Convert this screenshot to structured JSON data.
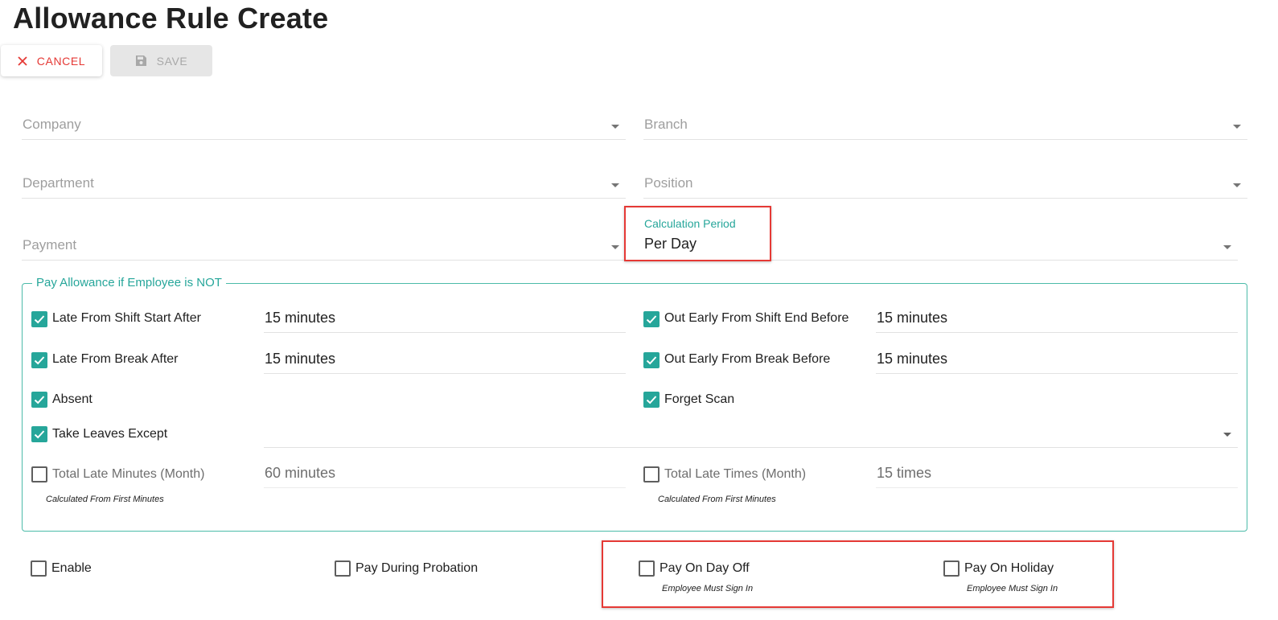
{
  "page": {
    "title": "Allowance Rule Create"
  },
  "toolbar": {
    "cancel_label": "CANCEL",
    "save_label": "SAVE"
  },
  "filters": {
    "company": {
      "placeholder": "Company"
    },
    "branch": {
      "placeholder": "Branch"
    },
    "department": {
      "placeholder": "Department"
    },
    "position": {
      "placeholder": "Position"
    },
    "payment": {
      "placeholder": "Payment"
    },
    "calculation_period": {
      "label": "Calculation Period",
      "value": "Per Day"
    }
  },
  "not_section": {
    "legend": "Pay Allowance if Employee is NOT",
    "late_shift_start": {
      "label": "Late From Shift Start After",
      "checked": true,
      "value": "15 minutes"
    },
    "out_early_shift_end": {
      "label": "Out Early From Shift End Before",
      "checked": true,
      "value": "15 minutes"
    },
    "late_break": {
      "label": "Late From Break After",
      "checked": true,
      "value": "15 minutes"
    },
    "out_early_break": {
      "label": "Out Early From Break Before",
      "checked": true,
      "value": "15 minutes"
    },
    "absent": {
      "label": "Absent",
      "checked": true
    },
    "forget_scan": {
      "label": "Forget Scan",
      "checked": true
    },
    "take_leaves": {
      "label": "Take Leaves Except",
      "checked": true,
      "value": ""
    },
    "total_late_minutes": {
      "label": "Total Late Minutes (Month)",
      "checked": false,
      "value": "60 minutes",
      "hint": "Calculated From First Minutes"
    },
    "total_late_times": {
      "label": "Total Late Times (Month)",
      "checked": false,
      "value": "15 times",
      "hint": "Calculated From First Minutes"
    }
  },
  "options": {
    "enable": {
      "label": "Enable",
      "checked": false
    },
    "pay_during_probation": {
      "label": "Pay During Probation",
      "checked": false
    },
    "pay_on_day_off": {
      "label": "Pay On Day Off",
      "checked": false,
      "hint": "Employee Must Sign In"
    },
    "pay_on_holiday": {
      "label": "Pay On Holiday",
      "checked": false,
      "hint": "Employee Must Sign In"
    }
  },
  "colors": {
    "accent": "#26a69a",
    "danger": "#e53935",
    "highlight_box": "#e53935"
  }
}
